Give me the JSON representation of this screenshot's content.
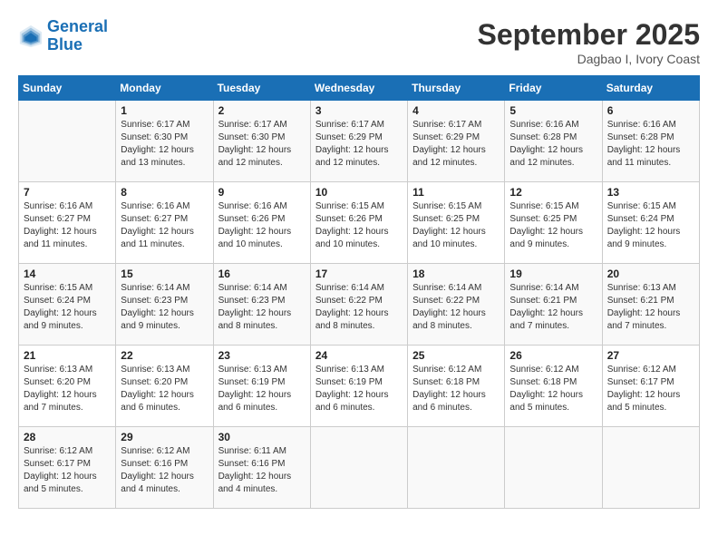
{
  "header": {
    "logo_line1": "General",
    "logo_line2": "Blue",
    "month": "September 2025",
    "location": "Dagbao I, Ivory Coast"
  },
  "days_of_week": [
    "Sunday",
    "Monday",
    "Tuesday",
    "Wednesday",
    "Thursday",
    "Friday",
    "Saturday"
  ],
  "weeks": [
    [
      {
        "day": "",
        "sunrise": "",
        "sunset": "",
        "daylight": ""
      },
      {
        "day": "1",
        "sunrise": "Sunrise: 6:17 AM",
        "sunset": "Sunset: 6:30 PM",
        "daylight": "Daylight: 12 hours and 13 minutes."
      },
      {
        "day": "2",
        "sunrise": "Sunrise: 6:17 AM",
        "sunset": "Sunset: 6:30 PM",
        "daylight": "Daylight: 12 hours and 12 minutes."
      },
      {
        "day": "3",
        "sunrise": "Sunrise: 6:17 AM",
        "sunset": "Sunset: 6:29 PM",
        "daylight": "Daylight: 12 hours and 12 minutes."
      },
      {
        "day": "4",
        "sunrise": "Sunrise: 6:17 AM",
        "sunset": "Sunset: 6:29 PM",
        "daylight": "Daylight: 12 hours and 12 minutes."
      },
      {
        "day": "5",
        "sunrise": "Sunrise: 6:16 AM",
        "sunset": "Sunset: 6:28 PM",
        "daylight": "Daylight: 12 hours and 12 minutes."
      },
      {
        "day": "6",
        "sunrise": "Sunrise: 6:16 AM",
        "sunset": "Sunset: 6:28 PM",
        "daylight": "Daylight: 12 hours and 11 minutes."
      }
    ],
    [
      {
        "day": "7",
        "sunrise": "Sunrise: 6:16 AM",
        "sunset": "Sunset: 6:27 PM",
        "daylight": "Daylight: 12 hours and 11 minutes."
      },
      {
        "day": "8",
        "sunrise": "Sunrise: 6:16 AM",
        "sunset": "Sunset: 6:27 PM",
        "daylight": "Daylight: 12 hours and 11 minutes."
      },
      {
        "day": "9",
        "sunrise": "Sunrise: 6:16 AM",
        "sunset": "Sunset: 6:26 PM",
        "daylight": "Daylight: 12 hours and 10 minutes."
      },
      {
        "day": "10",
        "sunrise": "Sunrise: 6:15 AM",
        "sunset": "Sunset: 6:26 PM",
        "daylight": "Daylight: 12 hours and 10 minutes."
      },
      {
        "day": "11",
        "sunrise": "Sunrise: 6:15 AM",
        "sunset": "Sunset: 6:25 PM",
        "daylight": "Daylight: 12 hours and 10 minutes."
      },
      {
        "day": "12",
        "sunrise": "Sunrise: 6:15 AM",
        "sunset": "Sunset: 6:25 PM",
        "daylight": "Daylight: 12 hours and 9 minutes."
      },
      {
        "day": "13",
        "sunrise": "Sunrise: 6:15 AM",
        "sunset": "Sunset: 6:24 PM",
        "daylight": "Daylight: 12 hours and 9 minutes."
      }
    ],
    [
      {
        "day": "14",
        "sunrise": "Sunrise: 6:15 AM",
        "sunset": "Sunset: 6:24 PM",
        "daylight": "Daylight: 12 hours and 9 minutes."
      },
      {
        "day": "15",
        "sunrise": "Sunrise: 6:14 AM",
        "sunset": "Sunset: 6:23 PM",
        "daylight": "Daylight: 12 hours and 9 minutes."
      },
      {
        "day": "16",
        "sunrise": "Sunrise: 6:14 AM",
        "sunset": "Sunset: 6:23 PM",
        "daylight": "Daylight: 12 hours and 8 minutes."
      },
      {
        "day": "17",
        "sunrise": "Sunrise: 6:14 AM",
        "sunset": "Sunset: 6:22 PM",
        "daylight": "Daylight: 12 hours and 8 minutes."
      },
      {
        "day": "18",
        "sunrise": "Sunrise: 6:14 AM",
        "sunset": "Sunset: 6:22 PM",
        "daylight": "Daylight: 12 hours and 8 minutes."
      },
      {
        "day": "19",
        "sunrise": "Sunrise: 6:14 AM",
        "sunset": "Sunset: 6:21 PM",
        "daylight": "Daylight: 12 hours and 7 minutes."
      },
      {
        "day": "20",
        "sunrise": "Sunrise: 6:13 AM",
        "sunset": "Sunset: 6:21 PM",
        "daylight": "Daylight: 12 hours and 7 minutes."
      }
    ],
    [
      {
        "day": "21",
        "sunrise": "Sunrise: 6:13 AM",
        "sunset": "Sunset: 6:20 PM",
        "daylight": "Daylight: 12 hours and 7 minutes."
      },
      {
        "day": "22",
        "sunrise": "Sunrise: 6:13 AM",
        "sunset": "Sunset: 6:20 PM",
        "daylight": "Daylight: 12 hours and 6 minutes."
      },
      {
        "day": "23",
        "sunrise": "Sunrise: 6:13 AM",
        "sunset": "Sunset: 6:19 PM",
        "daylight": "Daylight: 12 hours and 6 minutes."
      },
      {
        "day": "24",
        "sunrise": "Sunrise: 6:13 AM",
        "sunset": "Sunset: 6:19 PM",
        "daylight": "Daylight: 12 hours and 6 minutes."
      },
      {
        "day": "25",
        "sunrise": "Sunrise: 6:12 AM",
        "sunset": "Sunset: 6:18 PM",
        "daylight": "Daylight: 12 hours and 6 minutes."
      },
      {
        "day": "26",
        "sunrise": "Sunrise: 6:12 AM",
        "sunset": "Sunset: 6:18 PM",
        "daylight": "Daylight: 12 hours and 5 minutes."
      },
      {
        "day": "27",
        "sunrise": "Sunrise: 6:12 AM",
        "sunset": "Sunset: 6:17 PM",
        "daylight": "Daylight: 12 hours and 5 minutes."
      }
    ],
    [
      {
        "day": "28",
        "sunrise": "Sunrise: 6:12 AM",
        "sunset": "Sunset: 6:17 PM",
        "daylight": "Daylight: 12 hours and 5 minutes."
      },
      {
        "day": "29",
        "sunrise": "Sunrise: 6:12 AM",
        "sunset": "Sunset: 6:16 PM",
        "daylight": "Daylight: 12 hours and 4 minutes."
      },
      {
        "day": "30",
        "sunrise": "Sunrise: 6:11 AM",
        "sunset": "Sunset: 6:16 PM",
        "daylight": "Daylight: 12 hours and 4 minutes."
      },
      {
        "day": "",
        "sunrise": "",
        "sunset": "",
        "daylight": ""
      },
      {
        "day": "",
        "sunrise": "",
        "sunset": "",
        "daylight": ""
      },
      {
        "day": "",
        "sunrise": "",
        "sunset": "",
        "daylight": ""
      },
      {
        "day": "",
        "sunrise": "",
        "sunset": "",
        "daylight": ""
      }
    ]
  ]
}
